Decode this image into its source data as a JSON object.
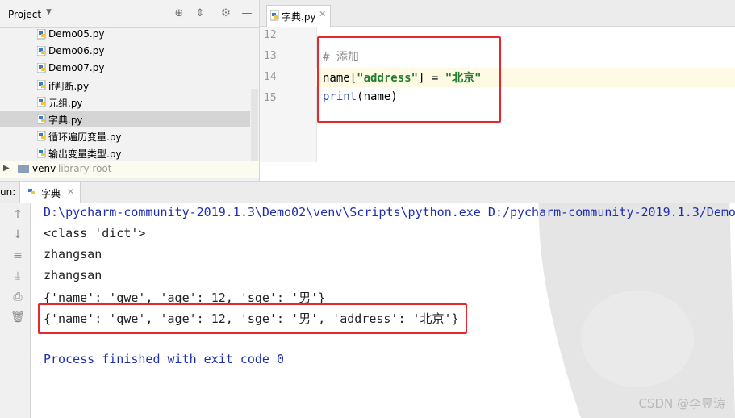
{
  "project": {
    "title": "Project",
    "files": [
      "Demo05.py",
      "Demo06.py",
      "Demo07.py",
      "if判断.py",
      "元组.py",
      "字典.py",
      "循环遍历变量.py",
      "输出变量类型.py"
    ],
    "selected_index": 5,
    "venv": {
      "name": "venv",
      "note": "library root"
    }
  },
  "editor": {
    "tab_label": "字典.py",
    "lines": [
      {
        "num": "12",
        "text": ""
      },
      {
        "num": "13",
        "comment": "# 添加"
      },
      {
        "num": "14",
        "prefix": "name[",
        "key": "\"address\"",
        "middle": "] = ",
        "value": "\"北京\""
      },
      {
        "num": "15",
        "fn": "print",
        "rest": "(name)"
      }
    ]
  },
  "run": {
    "label": "un:",
    "tab_label": "字典",
    "output": [
      "D:\\pycharm-community-2019.1.3\\Demo02\\venv\\Scripts\\python.exe D:/pycharm-community-2019.1.3/Demo0",
      "<class 'dict'>",
      "zhangsan",
      "zhangsan",
      "{'name': 'qwe', 'age': 12, 'sge': '男'}",
      "{'name': 'qwe', 'age': 12, 'sge': '男', 'address': '北京'}",
      "",
      "Process finished with exit code 0"
    ]
  },
  "watermark": "CSDN @李昱涛",
  "colors": {
    "highlight_box": "#e3292d",
    "keyword_green": "#1a7f2e",
    "path_blue": "#1e2fae",
    "builtin_blue": "#2c4ec2"
  }
}
